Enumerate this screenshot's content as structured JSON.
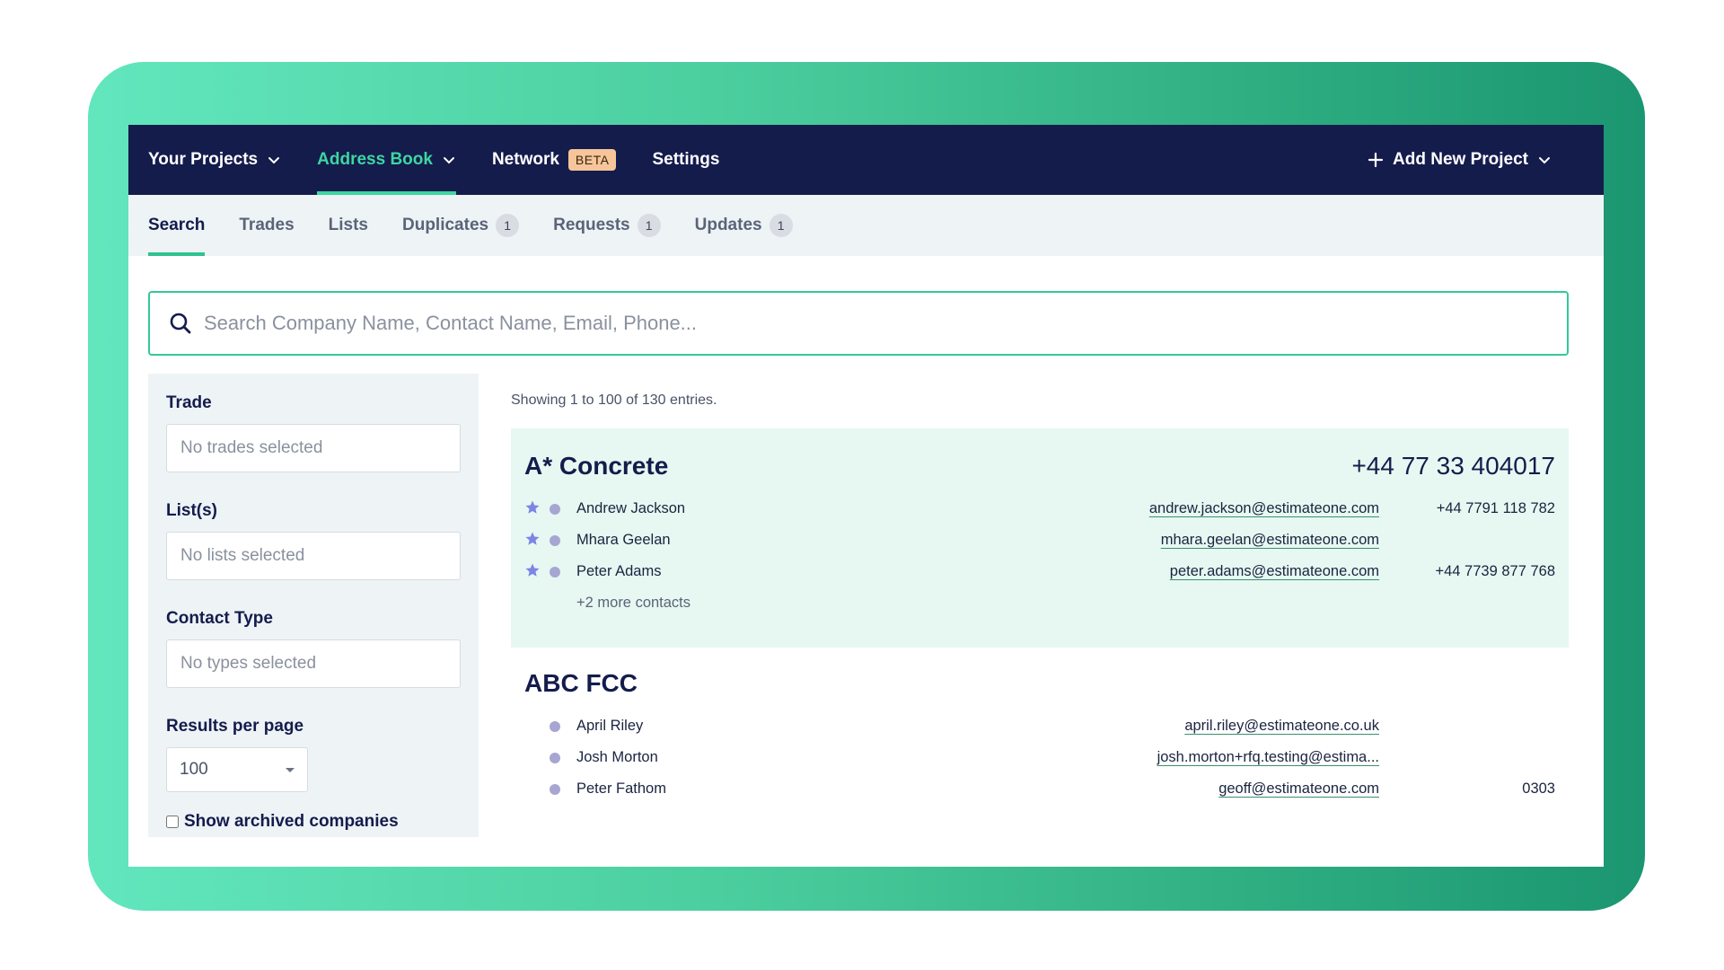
{
  "nav": {
    "items": [
      {
        "label": "Your Projects",
        "has_dropdown": true,
        "active": false
      },
      {
        "label": "Address Book",
        "has_dropdown": true,
        "active": true
      },
      {
        "label": "Network",
        "badge": "BETA",
        "active": false
      },
      {
        "label": "Settings",
        "active": false
      }
    ],
    "add_project_label": "Add New Project"
  },
  "tabs": [
    {
      "label": "Search",
      "active": true
    },
    {
      "label": "Trades"
    },
    {
      "label": "Lists"
    },
    {
      "label": "Duplicates",
      "count": "1"
    },
    {
      "label": "Requests",
      "count": "1"
    },
    {
      "label": "Updates",
      "count": "1"
    }
  ],
  "search": {
    "value": "",
    "placeholder": "Search Company Name, Contact Name, Email, Phone..."
  },
  "filters": {
    "trade": {
      "label": "Trade",
      "placeholder": "No trades selected"
    },
    "lists": {
      "label": "List(s)",
      "placeholder": "No lists selected"
    },
    "contact_type": {
      "label": "Contact Type",
      "placeholder": "No types selected"
    },
    "results_per_page": {
      "label": "Results per page",
      "value": "100"
    },
    "archived": {
      "label": "Show archived companies",
      "checked": false
    }
  },
  "results": {
    "summary": "Showing 1 to 100 of 130 entries.",
    "companies": [
      {
        "name": "A* Concrete",
        "phone": "+44 77 33 404017",
        "contacts": [
          {
            "name": "Andrew Jackson",
            "email": "andrew.jackson@estimateone.com",
            "phone": "+44 7791 118 782",
            "starred": true
          },
          {
            "name": "Mhara Geelan",
            "email": "mhara.geelan@estimateone.com",
            "phone": "",
            "starred": true
          },
          {
            "name": "Peter Adams",
            "email": "peter.adams@estimateone.com",
            "phone": "+44 7739 877 768",
            "starred": true
          }
        ],
        "more": "+2 more contacts"
      },
      {
        "name": "ABC FCC",
        "phone": "",
        "contacts": [
          {
            "name": "April Riley",
            "email": "april.riley@estimateone.co.uk",
            "phone": "",
            "starred": false
          },
          {
            "name": "Josh Morton",
            "email": "josh.morton+rfq.testing@estima...",
            "phone": "",
            "starred": false
          },
          {
            "name": "Peter Fathom",
            "email": "geoff@estimateone.com",
            "phone": "0303",
            "starred": false
          }
        ]
      }
    ]
  },
  "colors": {
    "navy": "#141c4c",
    "accent": "#3ed6a0",
    "highlight": "#e6f8f1",
    "star": "#7c84e6"
  }
}
